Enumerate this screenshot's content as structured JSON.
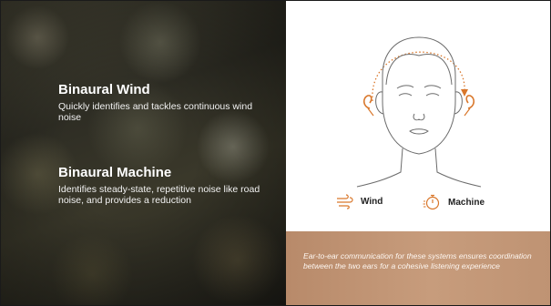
{
  "features": [
    {
      "title": "Binaural Wind",
      "description": "Quickly identifies and tackles continuous wind noise"
    },
    {
      "title": "Binaural Machine",
      "description": "Identifies steady-state, repetitive noise like road noise, and provides a reduction"
    }
  ],
  "legend": {
    "wind_label": "Wind",
    "wind_icon": "wind-icon",
    "machine_label": "Machine",
    "machine_icon": "stopwatch-icon"
  },
  "footer": {
    "text": "Ear-to-ear communication for these systems ensures coordination between the two ears for a cohesive listening experience"
  },
  "colors": {
    "accent": "#d9772b",
    "footer_bg": "#c49878",
    "line_art": "#6b6b6b"
  }
}
